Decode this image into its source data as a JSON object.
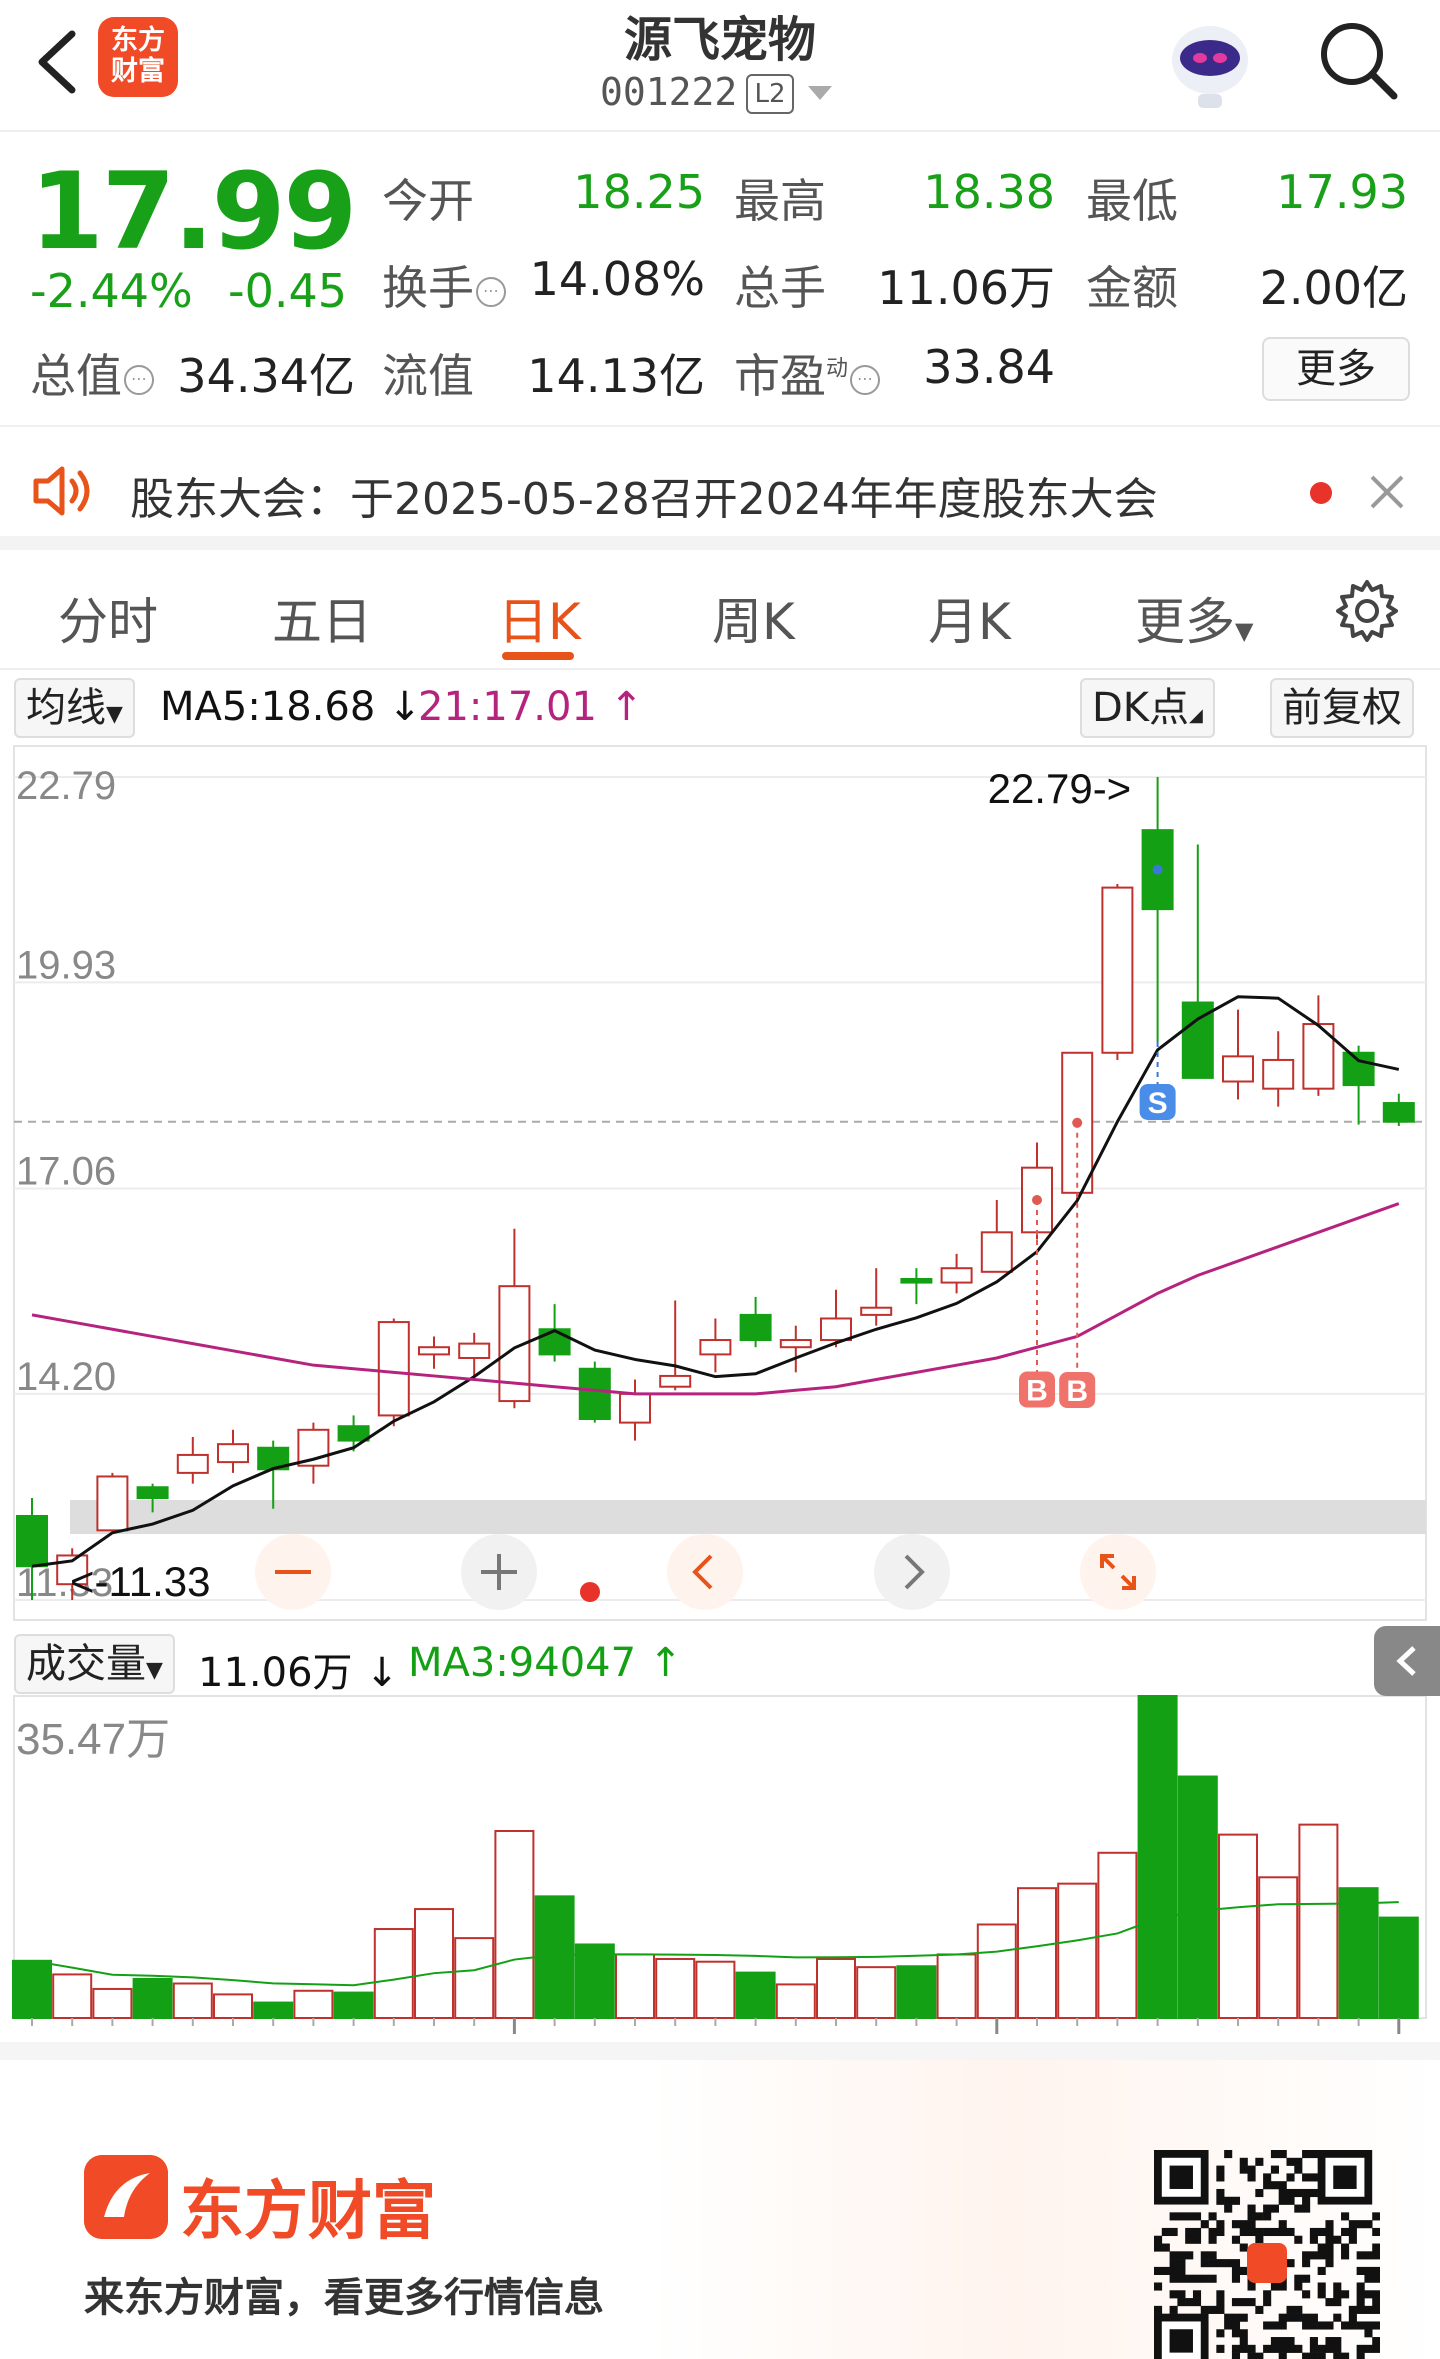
{
  "header": {
    "back_icon": "chevron-left-icon",
    "app_logo_text_1": "东方",
    "app_logo_text_2": "财富",
    "stock_name": "源飞宠物",
    "stock_code": "001222",
    "level_badge": "L2"
  },
  "quote": {
    "price": "17.99",
    "change_pct": "-2.44%",
    "change_amt": "-0.45",
    "open_label": "今开",
    "open": "18.25",
    "high_label": "最高",
    "high": "18.38",
    "low_label": "最低",
    "low": "17.93",
    "turnover_label": "换手",
    "turnover": "14.08%",
    "volume_label": "总手",
    "volume": "11.06万",
    "amount_label": "金额",
    "amount": "2.00亿",
    "mktcap_label": "总值",
    "mktcap": "34.34亿",
    "float_label": "流值",
    "float": "14.13亿",
    "pe_label": "市盈",
    "pe_sup": "动",
    "pe": "33.84",
    "more_label": "更多"
  },
  "notice": {
    "text": "股东大会：于2025-05-28召开2024年年度股东大会"
  },
  "tabs": [
    {
      "label": "分时"
    },
    {
      "label": "五日"
    },
    {
      "label": "日K",
      "active": true
    },
    {
      "label": "周K"
    },
    {
      "label": "月K"
    },
    {
      "label": "更多"
    }
  ],
  "ma_bar": {
    "selector": "均线",
    "ma5": "MA5:18.68",
    "ma21": "21:17.01",
    "dk": "DK点",
    "adjust": "前复权"
  },
  "colors": {
    "up": "#c0312d",
    "down": "#14a014",
    "ma5": "#111111",
    "ma21": "#b5237f",
    "accent": "#e8531a"
  },
  "chart_data": [
    {
      "type": "candlestick",
      "y_axis_labels": [
        "22.79",
        "19.93",
        "17.06",
        "14.20",
        "11.33"
      ],
      "ylim": [
        11.33,
        22.79
      ],
      "max_annotation": "22.79->",
      "min_annotation": "<-11.33",
      "candles": [
        {
          "o": 12.5,
          "c": 11.8,
          "h": 12.75,
          "l": 11.33
        },
        {
          "o": 11.55,
          "c": 11.95,
          "h": 12.05,
          "l": 11.33
        },
        {
          "o": 12.3,
          "c": 13.05,
          "h": 13.1,
          "l": 12.3
        },
        {
          "o": 12.9,
          "c": 12.75,
          "h": 12.95,
          "l": 12.55
        },
        {
          "o": 13.1,
          "c": 13.35,
          "h": 13.6,
          "l": 12.95
        },
        {
          "o": 13.25,
          "c": 13.5,
          "h": 13.7,
          "l": 13.1
        },
        {
          "o": 13.45,
          "c": 13.15,
          "h": 13.55,
          "l": 12.6
        },
        {
          "o": 13.2,
          "c": 13.7,
          "h": 13.8,
          "l": 12.95
        },
        {
          "o": 13.75,
          "c": 13.55,
          "h": 13.9,
          "l": 13.4
        },
        {
          "o": 13.9,
          "c": 15.2,
          "h": 15.25,
          "l": 13.75
        },
        {
          "o": 14.75,
          "c": 14.85,
          "h": 15.0,
          "l": 14.55
        },
        {
          "o": 14.7,
          "c": 14.9,
          "h": 15.05,
          "l": 14.45
        },
        {
          "o": 14.1,
          "c": 15.7,
          "h": 16.5,
          "l": 14.0
        },
        {
          "o": 15.1,
          "c": 14.75,
          "h": 15.45,
          "l": 14.65
        },
        {
          "o": 14.55,
          "c": 13.85,
          "h": 14.65,
          "l": 13.8
        },
        {
          "o": 13.8,
          "c": 14.2,
          "h": 14.4,
          "l": 13.55
        },
        {
          "o": 14.3,
          "c": 14.45,
          "h": 15.5,
          "l": 14.25
        },
        {
          "o": 14.75,
          "c": 14.95,
          "h": 15.25,
          "l": 14.5
        },
        {
          "o": 15.3,
          "c": 14.95,
          "h": 15.55,
          "l": 14.85
        },
        {
          "o": 14.85,
          "c": 14.95,
          "h": 15.15,
          "l": 14.5
        },
        {
          "o": 14.95,
          "c": 15.25,
          "h": 15.65,
          "l": 14.85
        },
        {
          "o": 15.3,
          "c": 15.4,
          "h": 15.95,
          "l": 15.15
        },
        {
          "o": 15.8,
          "c": 15.75,
          "h": 15.95,
          "l": 15.45
        },
        {
          "o": 15.75,
          "c": 15.95,
          "h": 16.15,
          "l": 15.6
        },
        {
          "o": 15.9,
          "c": 16.45,
          "h": 16.9,
          "l": 15.9
        },
        {
          "o": 16.45,
          "c": 17.35,
          "h": 17.7,
          "l": 16.35
        },
        {
          "o": 17.0,
          "c": 18.95,
          "h": 18.95,
          "l": 16.9
        },
        {
          "o": 18.95,
          "c": 21.25,
          "h": 21.3,
          "l": 18.85
        },
        {
          "o": 22.05,
          "c": 20.95,
          "h": 22.79,
          "l": 19.1
        },
        {
          "o": 19.65,
          "c": 18.6,
          "h": 21.85,
          "l": 18.6
        },
        {
          "o": 18.55,
          "c": 18.9,
          "h": 19.55,
          "l": 18.3
        },
        {
          "o": 18.45,
          "c": 18.85,
          "h": 19.25,
          "l": 18.2
        },
        {
          "o": 18.45,
          "c": 19.35,
          "h": 19.75,
          "l": 18.35
        },
        {
          "o": 18.95,
          "c": 18.5,
          "h": 19.05,
          "l": 17.95
        },
        {
          "o": 18.25,
          "c": 17.99,
          "h": 18.38,
          "l": 17.93
        }
      ],
      "ma5_label": "MA5",
      "ma21_label": "21",
      "signals": [
        {
          "label": "S",
          "index": 28
        },
        {
          "label": "B",
          "index": 25
        },
        {
          "label": "B",
          "index": 26
        }
      ],
      "current_price_line": 17.99
    },
    {
      "type": "bar",
      "title": "成交量",
      "value_label": "11.06万",
      "ma_label": "MA3:94047",
      "y_max_label": "35.47万",
      "ylim": [
        0,
        35.47
      ],
      "values_wan": [
        6.3,
        4.8,
        3.2,
        4.3,
        3.8,
        2.6,
        1.7,
        3.0,
        2.8,
        9.8,
        12.0,
        8.8,
        20.6,
        13.4,
        8.1,
        7.0,
        6.5,
        6.2,
        5.0,
        3.7,
        6.5,
        5.6,
        5.7,
        7.0,
        10.3,
        14.3,
        14.8,
        18.2,
        35.47,
        26.6,
        20.2,
        15.5,
        21.3,
        14.3,
        11.06
      ]
    }
  ],
  "chart_controls": {
    "zoom_out": "—",
    "zoom_in": "+",
    "prev": "<",
    "next": ">"
  },
  "promo": {
    "brand": "东方财富",
    "subtitle": "来东方财富，看更多行情信息"
  }
}
